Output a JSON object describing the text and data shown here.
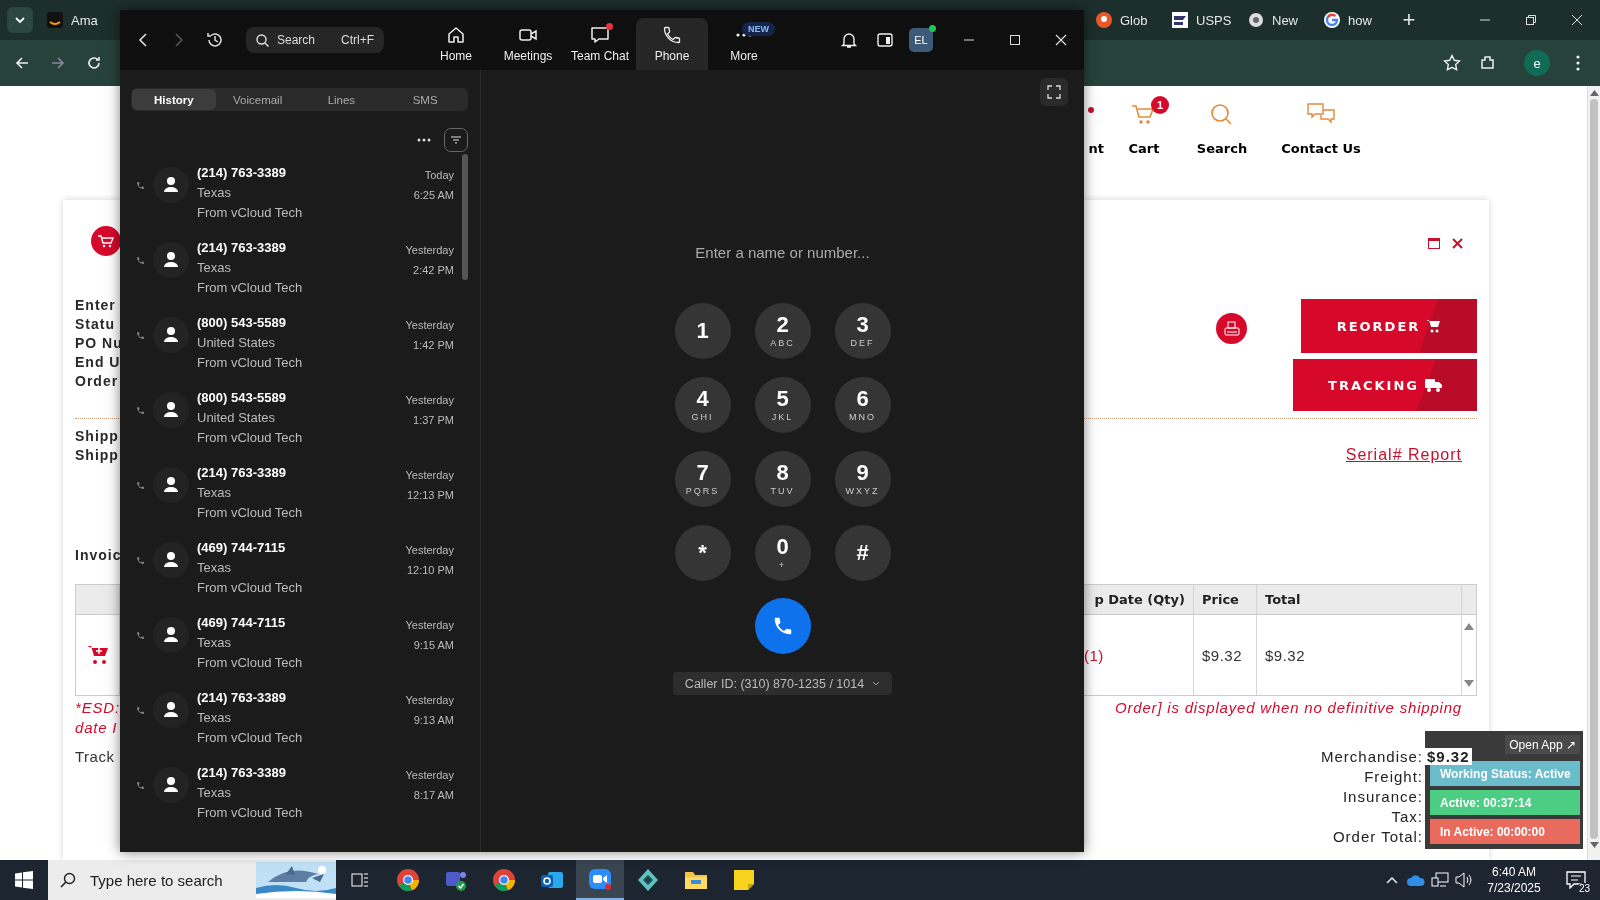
{
  "browser": {
    "tabs": [
      {
        "title": "Ama",
        "kind": "smile"
      },
      {
        "title": "Glob",
        "kind": "pin"
      },
      {
        "title": "USPS",
        "kind": "flag"
      },
      {
        "title": "New",
        "kind": "globe"
      },
      {
        "title": "how",
        "kind": "ring"
      }
    ],
    "new_tab": "+",
    "profile_initial": "e"
  },
  "page": {
    "nav": [
      {
        "label": "nt",
        "kind": "cut"
      },
      {
        "label": "Cart",
        "kind": "cart",
        "badge": "1"
      },
      {
        "label": "Search",
        "kind": "search"
      },
      {
        "label": "Contact Us",
        "kind": "contact"
      }
    ],
    "order_labels": [
      "Enter",
      "Statu",
      "PO Nu",
      "End U",
      "Order"
    ],
    "buttons": [
      {
        "label": "REORDER",
        "kind": "reorder"
      },
      {
        "label": "TRACKING",
        "kind": "tracking"
      }
    ],
    "shipping_labels": [
      "Shipp",
      "Shipp"
    ],
    "serial_link": "Serial# Report",
    "invoice_label": "Invoic",
    "table": {
      "columns": [
        "p Date (Qty)",
        "Price",
        "Total"
      ],
      "rows": [
        {
          "cells": [
            "(1)",
            "$9.32",
            "$9.32"
          ]
        }
      ]
    },
    "note_left": [
      "*ESD:",
      "date I"
    ],
    "note_right": "Order] is displayed when no definitive shipping",
    "track_label": "Track",
    "summary": [
      {
        "label": "Merchandise:",
        "value": "$9.32"
      },
      {
        "label": "Freight:"
      },
      {
        "label": "Insurance:"
      },
      {
        "label": "Tax:"
      },
      {
        "label": "Order Total:"
      }
    ]
  },
  "zoom": {
    "search": {
      "placeholder": "Search",
      "shortcut": "Ctrl+F"
    },
    "nav": [
      {
        "label": "Home",
        "kind": "home",
        "selected": false,
        "unread": false
      },
      {
        "label": "Meetings",
        "kind": "meetings",
        "selected": false,
        "unread": false
      },
      {
        "label": "Team Chat",
        "kind": "chat",
        "selected": false,
        "unread": true
      },
      {
        "label": "Phone",
        "kind": "phone",
        "selected": true,
        "unread": false
      },
      {
        "label": "More",
        "kind": "more",
        "selected": false,
        "unread": false,
        "badge": "NEW"
      }
    ],
    "avatar": {
      "initials": "EL",
      "online": true
    },
    "tabs": [
      {
        "label": "History",
        "selected": true
      },
      {
        "label": "Voicemail",
        "selected": false
      },
      {
        "label": "Lines",
        "selected": false
      },
      {
        "label": "SMS",
        "selected": false
      }
    ],
    "calls": [
      {
        "number": "(214) 763-3389",
        "region": "Texas",
        "source": "From vCloud Tech",
        "date": "Today",
        "time": "6:25 AM"
      },
      {
        "number": "(214) 763-3389",
        "region": "Texas",
        "source": "From vCloud Tech",
        "date": "Yesterday",
        "time": "2:42 PM"
      },
      {
        "number": "(800) 543-5589",
        "region": "United States",
        "source": "From vCloud Tech",
        "date": "Yesterday",
        "time": "1:42 PM"
      },
      {
        "number": "(800) 543-5589",
        "region": "United States",
        "source": "From vCloud Tech",
        "date": "Yesterday",
        "time": "1:37 PM"
      },
      {
        "number": "(214) 763-3389",
        "region": "Texas",
        "source": "From vCloud Tech",
        "date": "Yesterday",
        "time": "12:13 PM"
      },
      {
        "number": "(469) 744-7115",
        "region": "Texas",
        "source": "From vCloud Tech",
        "date": "Yesterday",
        "time": "12:10 PM"
      },
      {
        "number": "(469) 744-7115",
        "region": "Texas",
        "source": "From vCloud Tech",
        "date": "Yesterday",
        "time": "9:15 AM"
      },
      {
        "number": "(214) 763-3389",
        "region": "Texas",
        "source": "From vCloud Tech",
        "date": "Yesterday",
        "time": "9:13 AM"
      },
      {
        "number": "(214) 763-3389",
        "region": "Texas",
        "source": "From vCloud Tech",
        "date": "Yesterday",
        "time": "8:17 AM"
      }
    ],
    "dial": {
      "placeholder": "Enter a name or number...",
      "keys": [
        {
          "digit": "1"
        },
        {
          "digit": "2",
          "letters": "ABC"
        },
        {
          "digit": "3",
          "letters": "DEF"
        },
        {
          "digit": "4",
          "letters": "GHI"
        },
        {
          "digit": "5",
          "letters": "JKL"
        },
        {
          "digit": "6",
          "letters": "MNO"
        },
        {
          "digit": "7",
          "letters": "PQRS"
        },
        {
          "digit": "8",
          "letters": "TUV"
        },
        {
          "digit": "9",
          "letters": "WXYZ"
        },
        {
          "digit": "*"
        },
        {
          "digit": "0",
          "letters": "+"
        },
        {
          "digit": "#"
        }
      ],
      "caller_id": "Caller ID: (310) 870-1235 / 1014"
    }
  },
  "tracker": {
    "open_app": "Open App ↗",
    "rows": [
      {
        "text": "Working Status: Active",
        "color": "#6bbccb"
      },
      {
        "text": "Active: 00:37:14",
        "color": "#4ccd84"
      },
      {
        "text": "In Active: 00:00:00",
        "color": "#e96b5d"
      }
    ]
  },
  "taskbar": {
    "search_placeholder": "Type here to search",
    "apps": [
      {
        "kind": "chrome",
        "active": false
      },
      {
        "kind": "teams",
        "active": false
      },
      {
        "kind": "chrome",
        "active": false
      },
      {
        "kind": "outlook",
        "active": false
      },
      {
        "kind": "zoom",
        "active": true
      },
      {
        "kind": "diamond",
        "active": false
      },
      {
        "kind": "folder",
        "active": false
      },
      {
        "kind": "note",
        "active": false
      }
    ],
    "time": "6:40 AM",
    "date": "7/23/2025",
    "notifications": "23"
  }
}
